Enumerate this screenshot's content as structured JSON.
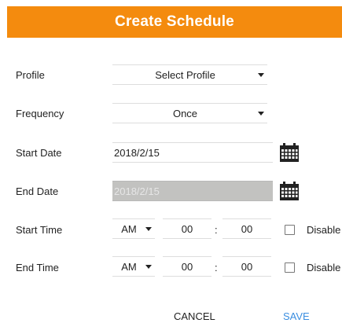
{
  "dialog": {
    "title": "Create Schedule"
  },
  "form": {
    "profile": {
      "label": "Profile",
      "value": "Select Profile"
    },
    "frequency": {
      "label": "Frequency",
      "value": "Once"
    },
    "start_date": {
      "label": "Start Date",
      "value": "2018/2/15"
    },
    "end_date": {
      "label": "End Date",
      "value": "2018/2/15"
    },
    "start_time": {
      "label": "Start Time",
      "ampm": "AM",
      "hour": "00",
      "separator": ":",
      "minute": "00",
      "disable_label": "Disable",
      "disable_checked": false
    },
    "end_time": {
      "label": "End Time",
      "ampm": "AM",
      "hour": "00",
      "separator": ":",
      "minute": "00",
      "disable_label": "Disable",
      "disable_checked": false
    }
  },
  "actions": {
    "cancel_label": "CANCEL",
    "save_label": "SAVE"
  },
  "colors": {
    "header": "#f48b0e",
    "save": "#3b8ee0",
    "disabled_input": "#c2c2c0"
  },
  "icons": {
    "calendar": "calendar-icon",
    "dropdown": "chevron-down-icon"
  }
}
